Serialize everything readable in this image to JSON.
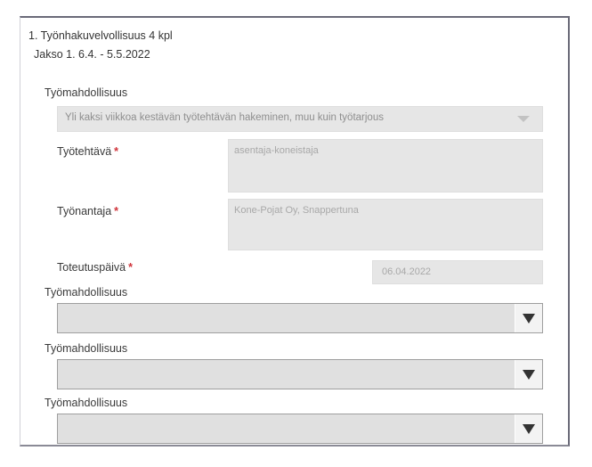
{
  "header": {
    "title": "1. Työnhakuvelvollisuus 4 kpl",
    "period": "Jakso 1. 6.4. - 5.5.2022"
  },
  "opportunity": {
    "label": "Työmahdollisuus",
    "selected": "Yli kaksi viikkoa kestävän työtehtävän hakeminen, muu kuin työtarjous"
  },
  "fields": {
    "task": {
      "label": "Työtehtävä",
      "value": "asentaja-koneistaja"
    },
    "employer": {
      "label": "Työnantaja",
      "value": "Kone-Pojat Oy, Snappertuna"
    },
    "date": {
      "label": "Toteutuspäivä",
      "value": "06.04.2022"
    },
    "required_mark": "*"
  },
  "empty_opportunities": [
    {
      "label": "Työmahdollisuus",
      "value": ""
    },
    {
      "label": "Työmahdollisuus",
      "value": ""
    },
    {
      "label": "Työmahdollisuus",
      "value": ""
    }
  ],
  "icons": {
    "dropdown": "triangle-down-icon",
    "dropdown_disabled": "chevron-down-icon"
  },
  "colors": {
    "required": "#d0343b",
    "disabled_bg": "#e6e6e6",
    "dropdown_bg": "#e0e0e0"
  }
}
